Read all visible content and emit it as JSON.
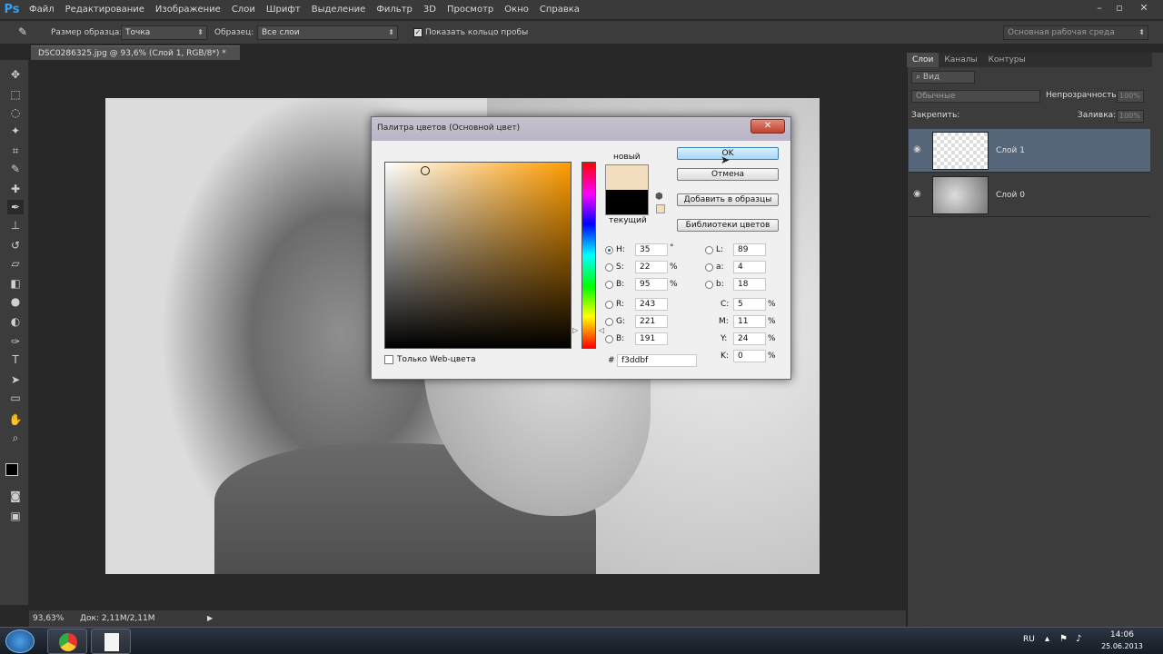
{
  "app": {
    "logo": "Ps"
  },
  "menu": [
    "Файл",
    "Редактирование",
    "Изображение",
    "Слои",
    "Шрифт",
    "Выделение",
    "Фильтр",
    "3D",
    "Просмотр",
    "Окно",
    "Справка"
  ],
  "options": {
    "sample_size_label": "Размер образца:",
    "sample_size_value": "Точка",
    "sample_label": "Образец:",
    "sample_value": "Все слои",
    "show_ring_label": "Показать кольцо пробы",
    "workspace_value": "Основная рабочая среда"
  },
  "document": {
    "tab": "DSC0286325.jpg @ 93,6% (Слой 1, RGB/8*) *"
  },
  "status": {
    "zoom": "93,63%",
    "doc": "Док: 2,11M/2,11M"
  },
  "panels": {
    "tabs": [
      "Слои",
      "Каналы",
      "Контуры"
    ],
    "kind": "Вид",
    "blend": "Обычные",
    "opacity_label": "Непрозрачность:",
    "opacity_value": "100%",
    "lock_label": "Закрепить:",
    "fill_label": "Заливка:",
    "fill_value": "100%",
    "layers": [
      {
        "name": "Слой 1"
      },
      {
        "name": "Слой 0"
      }
    ]
  },
  "dialog": {
    "title": "Палитра цветов (Основной цвет)",
    "new_label": "новый",
    "current_label": "текущий",
    "new_color": "#f3ddbf",
    "current_color": "#000000",
    "buttons": {
      "ok": "OK",
      "cancel": "Отмена",
      "add": "Добавить в образцы",
      "libraries": "Библиотеки цветов"
    },
    "web_only": "Только Web-цвета",
    "hex_label": "#",
    "hex": "f3ddbf",
    "hsb": [
      {
        "label": "H:",
        "value": "35",
        "unit": "°"
      },
      {
        "label": "S:",
        "value": "22",
        "unit": "%"
      },
      {
        "label": "B:",
        "value": "95",
        "unit": "%"
      }
    ],
    "rgb": [
      {
        "label": "R:",
        "value": "243"
      },
      {
        "label": "G:",
        "value": "221"
      },
      {
        "label": "B:",
        "value": "191"
      }
    ],
    "lab": [
      {
        "label": "L:",
        "value": "89"
      },
      {
        "label": "a:",
        "value": "4"
      },
      {
        "label": "b:",
        "value": "18"
      }
    ],
    "cmyk": [
      {
        "label": "C:",
        "value": "5",
        "unit": "%"
      },
      {
        "label": "M:",
        "value": "11",
        "unit": "%"
      },
      {
        "label": "Y:",
        "value": "24",
        "unit": "%"
      },
      {
        "label": "K:",
        "value": "0",
        "unit": "%"
      }
    ]
  },
  "taskbar": {
    "lang": "RU",
    "time": "14:06",
    "date": "25.06.2013"
  }
}
